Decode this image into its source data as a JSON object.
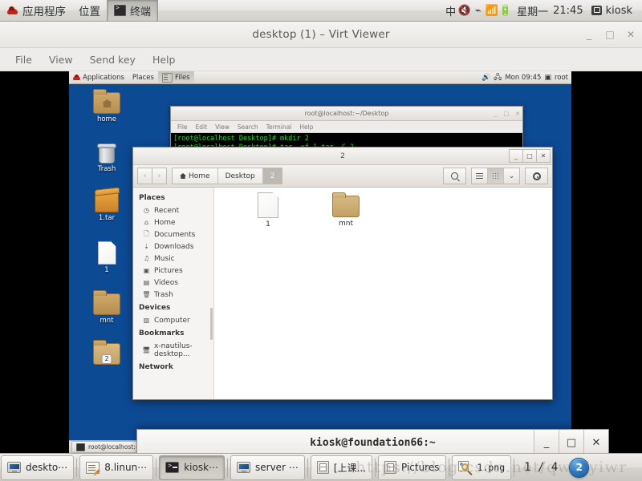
{
  "host_panel": {
    "menus": [
      "应用程序",
      "位置"
    ],
    "active_window": "终端",
    "tray": {
      "input_method": "中",
      "volume_icon": "volume-muted-icon",
      "bluetooth_icon": "bluetooth-icon",
      "network_icon": "wifi-icon",
      "battery_icon": "battery-charging-icon"
    },
    "day": "星期一",
    "clock": "21:45",
    "user": "kiosk"
  },
  "virt_viewer": {
    "title": "desktop (1) – Virt Viewer",
    "menus": [
      "File",
      "View",
      "Send key",
      "Help"
    ],
    "window_buttons": {
      "minimize": "_",
      "maximize": "□",
      "close": "✕"
    }
  },
  "guest": {
    "panel": {
      "applications": "Applications",
      "places": "Places",
      "files": "Files",
      "clock": "Mon 09:45",
      "user": "root"
    },
    "desktop_icons": [
      {
        "name": "home",
        "type": "folder-home"
      },
      {
        "name": "Trash",
        "type": "trash"
      },
      {
        "name": "1.tar",
        "type": "archive"
      },
      {
        "name": "1",
        "type": "file"
      },
      {
        "name": "mnt",
        "type": "folder"
      },
      {
        "name": "2",
        "type": "folder",
        "badge": "2"
      }
    ],
    "terminal": {
      "title": "root@localhost:~/Desktop",
      "menus": [
        "File",
        "Edit",
        "View",
        "Search",
        "Terminal",
        "Help"
      ],
      "lines": [
        "[root@localhost Desktop]# mkdir 2",
        "[root@localhost Desktop]# tar -xf 1.tar -C 2"
      ],
      "prompt": "[root@localhost Desktop]# "
    },
    "file_manager": {
      "title": "2",
      "breadcrumbs": [
        {
          "label": "Home",
          "icon": "home-icon",
          "current": false
        },
        {
          "label": "Desktop",
          "icon": "",
          "current": false
        },
        {
          "label": "2",
          "icon": "",
          "current": true
        }
      ],
      "toolbar": {
        "back": "‹",
        "forward": "›",
        "search_icon": "search-icon",
        "list_view_icon": "list-view-icon",
        "grid_view_icon": "grid-view-icon",
        "view_dropdown_icon": "chevron-down-icon",
        "settings_icon": "gear-icon"
      },
      "sidebar": [
        {
          "type": "header",
          "label": "Places"
        },
        {
          "type": "item",
          "label": "Recent",
          "icon": "clock-icon"
        },
        {
          "type": "item",
          "label": "Home",
          "icon": "home-icon"
        },
        {
          "type": "item",
          "label": "Documents",
          "icon": "document-icon"
        },
        {
          "type": "item",
          "label": "Downloads",
          "icon": "download-icon"
        },
        {
          "type": "item",
          "label": "Music",
          "icon": "music-icon"
        },
        {
          "type": "item",
          "label": "Pictures",
          "icon": "camera-icon"
        },
        {
          "type": "item",
          "label": "Videos",
          "icon": "film-icon"
        },
        {
          "type": "item",
          "label": "Trash",
          "icon": "trash-icon"
        },
        {
          "type": "header",
          "label": "Devices"
        },
        {
          "type": "item",
          "label": "Computer",
          "icon": "computer-icon"
        },
        {
          "type": "header",
          "label": "Bookmarks"
        },
        {
          "type": "item",
          "label": "x-nautilus-desktop...",
          "icon": "desktop-icon"
        },
        {
          "type": "header",
          "label": "Network"
        }
      ],
      "files": [
        {
          "name": "1",
          "type": "file"
        },
        {
          "name": "mnt",
          "type": "folder"
        }
      ]
    },
    "taskbar": [
      {
        "label": "root@localhost:~/",
        "icon": "terminal-icon"
      }
    ]
  },
  "host_terminal_window": {
    "title": "kiosk@foundation66:~",
    "buttons": {
      "minimize": "_",
      "maximize": "□",
      "close": "✕"
    }
  },
  "host_taskbar": {
    "items": [
      {
        "label": "deskto⋯",
        "icon": "monitor-icon",
        "active": false
      },
      {
        "label": "8.linun⋯",
        "icon": "text-editor-icon",
        "active": false
      },
      {
        "label": "kiosk⋯",
        "icon": "terminal-icon",
        "active": true
      },
      {
        "label": "server ⋯",
        "icon": "monitor-icon",
        "active": false
      },
      {
        "label": "[上课...",
        "icon": "file-cabinet-icon",
        "active": false
      },
      {
        "label": "Pictures",
        "icon": "file-cabinet-icon",
        "active": false
      },
      {
        "label": "1.png",
        "icon": "image-viewer-icon",
        "active": false
      }
    ],
    "window_counter": "1 / 4",
    "workspace": "2"
  },
  "watermark": "https://blog.csdn.net/qwefyiwr"
}
